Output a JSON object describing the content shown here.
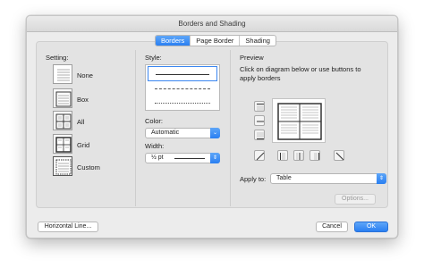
{
  "window": {
    "title": "Borders and Shading"
  },
  "tabs": [
    {
      "label": "Borders",
      "active": true
    },
    {
      "label": "Page Border",
      "active": false
    },
    {
      "label": "Shading",
      "active": false
    }
  ],
  "setting": {
    "heading": "Setting:",
    "options": [
      {
        "label": "None",
        "icon": "none-table-icon"
      },
      {
        "label": "Box",
        "icon": "box-table-icon"
      },
      {
        "label": "All",
        "icon": "all-table-icon"
      },
      {
        "label": "Grid",
        "icon": "grid-table-icon"
      },
      {
        "label": "Custom",
        "icon": "custom-table-icon",
        "selected": true
      }
    ]
  },
  "style": {
    "heading": "Style:",
    "items": [
      "solid",
      "dashed",
      "dotted"
    ],
    "color_label": "Color:",
    "color_value": "Automatic",
    "width_label": "Width:",
    "width_value": "½ pt"
  },
  "preview": {
    "heading": "Preview",
    "instructions": "Click on diagram below or use buttons to apply borders",
    "apply_label": "Apply to:",
    "apply_value": "Table",
    "options_button": "Options..."
  },
  "footer": {
    "horizontal_line": "Horizontal Line...",
    "cancel": "Cancel",
    "ok": "OK"
  },
  "colors": {
    "accent": "#2a7ff2"
  }
}
